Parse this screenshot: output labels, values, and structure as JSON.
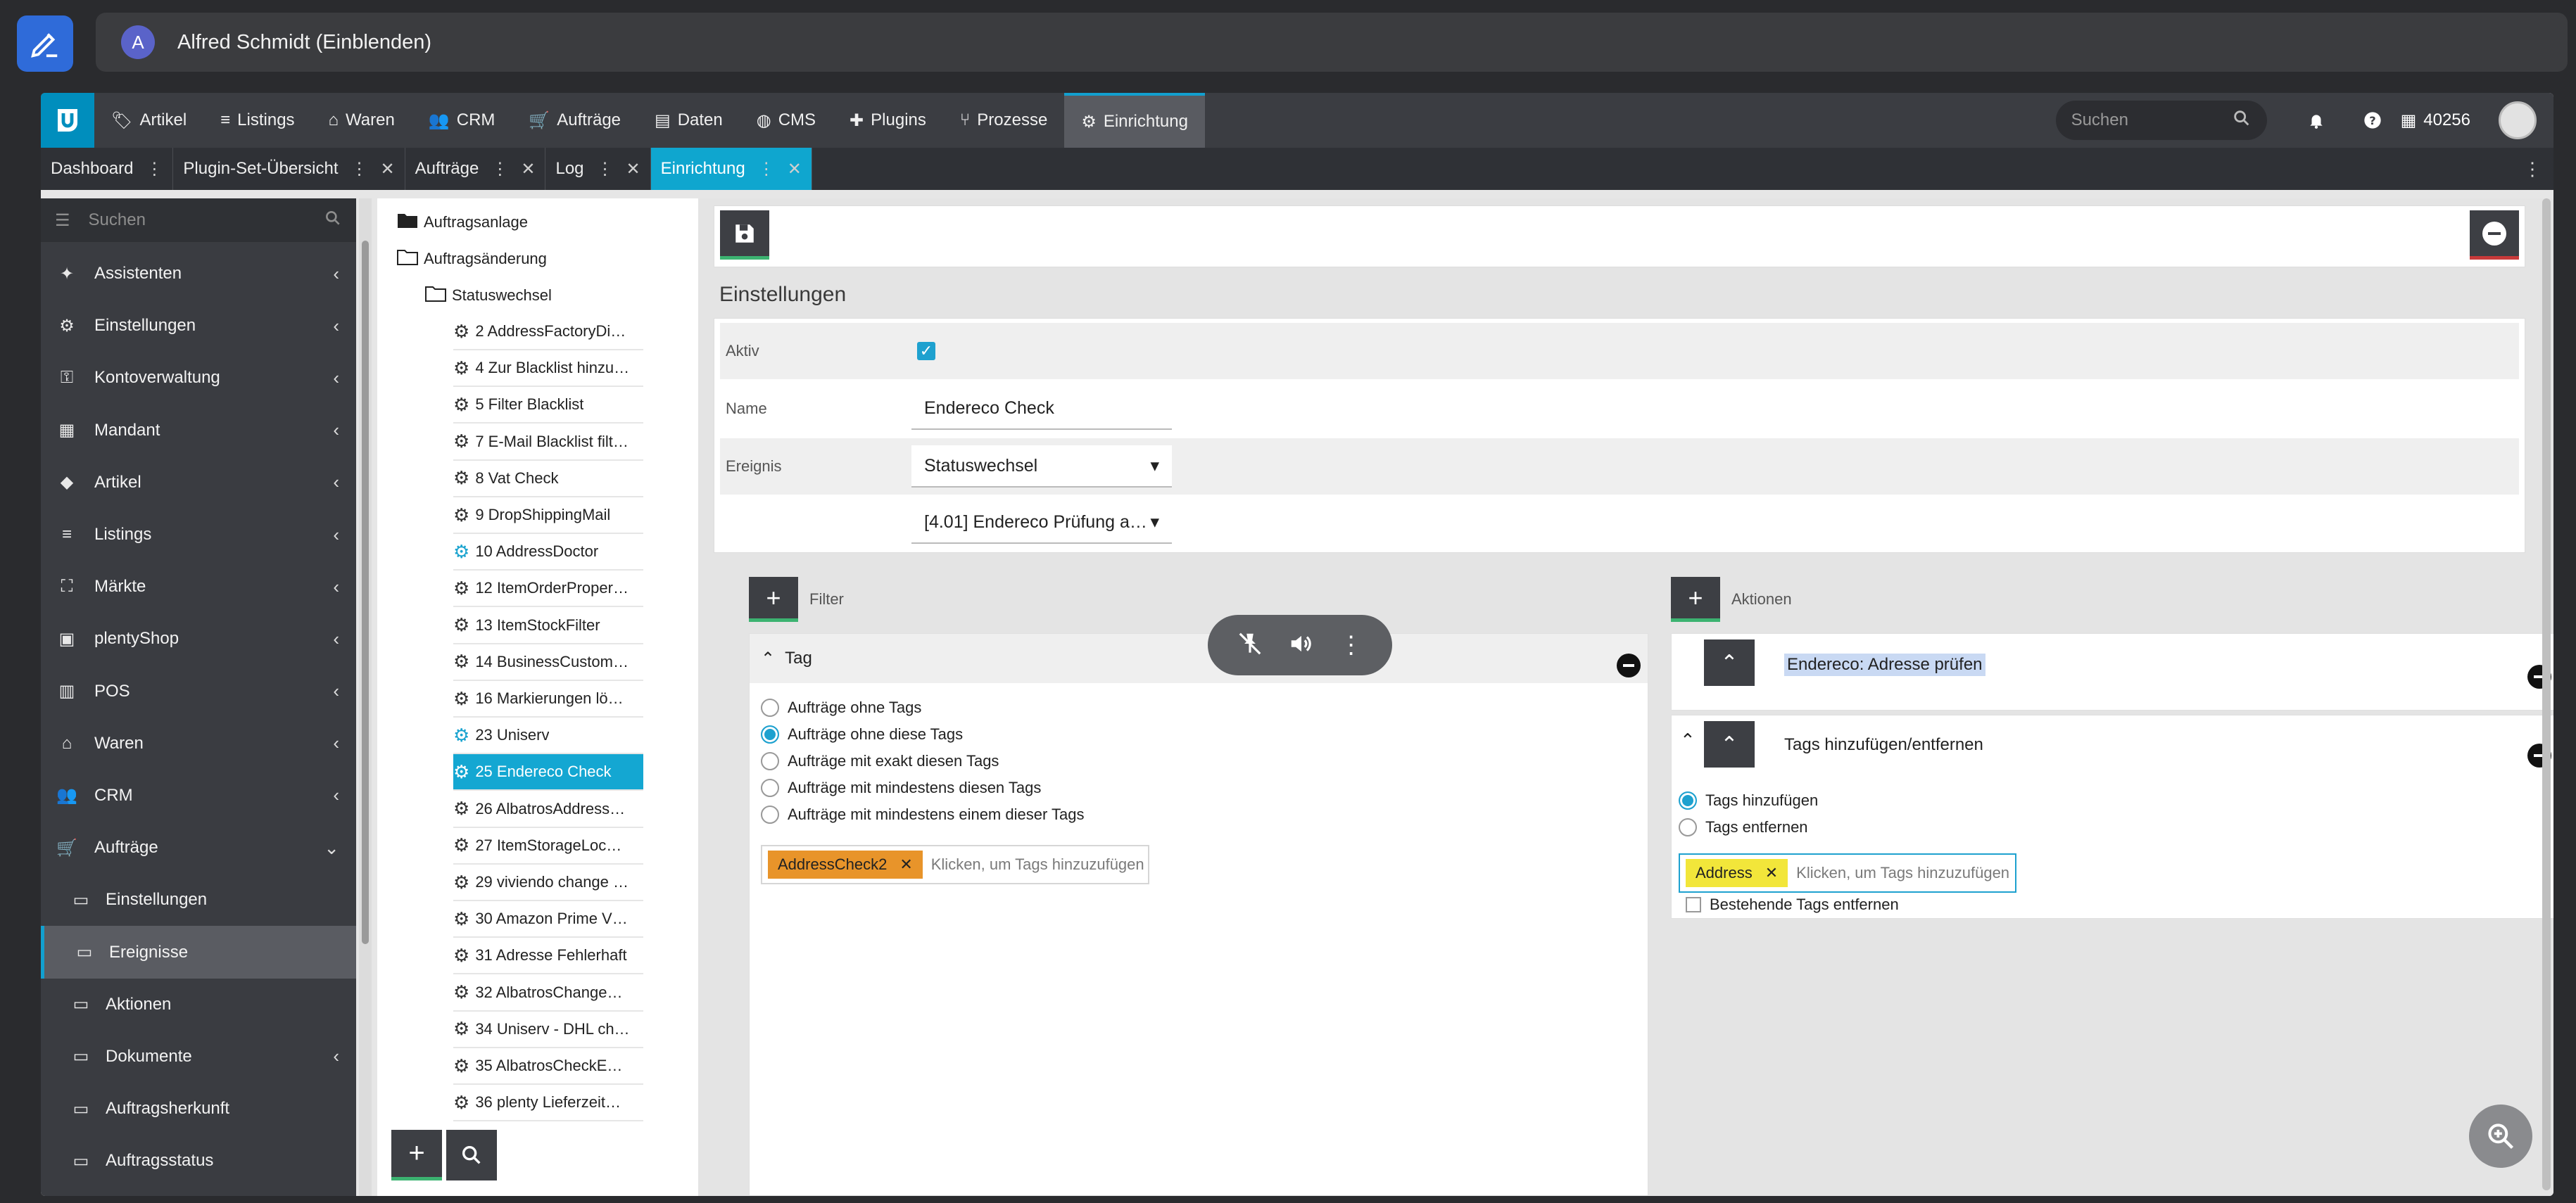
{
  "meeting": {
    "user_initial": "A",
    "user_name": "Alfred Schmidt (Einblenden)"
  },
  "topnav": {
    "items": [
      {
        "label": "Artikel",
        "icon": "tag-icon"
      },
      {
        "label": "Listings",
        "icon": "list-icon"
      },
      {
        "label": "Waren",
        "icon": "warehouse-icon"
      },
      {
        "label": "CRM",
        "icon": "people-icon"
      },
      {
        "label": "Aufträge",
        "icon": "cart-icon"
      },
      {
        "label": "Daten",
        "icon": "database-icon"
      },
      {
        "label": "CMS",
        "icon": "globe-icon"
      },
      {
        "label": "Plugins",
        "icon": "puzzle-icon"
      },
      {
        "label": "Prozesse",
        "icon": "process-icon"
      },
      {
        "label": "Einrichtung",
        "icon": "gear-icon"
      }
    ],
    "active": "Einrichtung",
    "search_placeholder": "Suchen",
    "account_id": "40256"
  },
  "tabs": [
    {
      "label": "Dashboard"
    },
    {
      "label": "Plugin-Set-Übersicht"
    },
    {
      "label": "Aufträge"
    },
    {
      "label": "Log"
    },
    {
      "label": "Einrichtung"
    }
  ],
  "sidebar": {
    "search_placeholder": "Suchen",
    "items": [
      {
        "label": "Assistenten",
        "icon": "wizard-icon",
        "chevron": "‹"
      },
      {
        "label": "Einstellungen",
        "icon": "gear-icon",
        "chevron": "‹"
      },
      {
        "label": "Kontoverwaltung",
        "icon": "key-icon",
        "chevron": "‹"
      },
      {
        "label": "Mandant",
        "icon": "store-icon",
        "chevron": "‹"
      },
      {
        "label": "Artikel",
        "icon": "tag-icon",
        "chevron": "‹"
      },
      {
        "label": "Listings",
        "icon": "list-icon",
        "chevron": "‹"
      },
      {
        "label": "Märkte",
        "icon": "market-icon",
        "chevron": "‹"
      },
      {
        "label": "plentyShop",
        "icon": "shop-icon",
        "chevron": "‹"
      },
      {
        "label": "POS",
        "icon": "pos-icon",
        "chevron": "‹"
      },
      {
        "label": "Waren",
        "icon": "warehouse-icon",
        "chevron": "‹"
      },
      {
        "label": "CRM",
        "icon": "people-icon",
        "chevron": "‹"
      },
      {
        "label": "Aufträge",
        "icon": "cart-icon",
        "chevron": "⌄"
      }
    ],
    "subitems": [
      {
        "label": "Einstellungen"
      },
      {
        "label": "Ereignisse"
      },
      {
        "label": "Aktionen"
      },
      {
        "label": "Dokumente",
        "chevron": "‹"
      },
      {
        "label": "Auftragsherkunft"
      },
      {
        "label": "Auftragsstatus"
      }
    ]
  },
  "tree": {
    "folders": [
      "Auftragsanlage",
      "Auftragsänderung",
      "Statuswechsel"
    ],
    "items": [
      "2 AddressFactoryDi…",
      "4 Zur Blacklist hinzu…",
      "5 Filter Blacklist",
      "7 E-Mail Blacklist filt…",
      "8 Vat Check",
      "9 DropShippingMail",
      "10 AddressDoctor",
      "12 ItemOrderProper…",
      "13 ItemStockFilter",
      "14 BusinessCustom…",
      "16 Markierungen lö…",
      "23 Uniserv",
      "25 Endereco Check",
      "26 AlbatrosAddress…",
      "27 ItemStorageLoc…",
      "29 viviendo change …",
      "30 Amazon Prime V…",
      "31 Adresse Fehlerhaft",
      "32 AlbatrosChange…",
      "34 Uniserv - DHL ch…",
      "35 AlbatrosCheckE…",
      "36 plenty Lieferzeit…"
    ],
    "selected": "25 Endereco Check"
  },
  "main": {
    "title": "Einstellungen",
    "fields": {
      "aktiv_label": "Aktiv",
      "name_label": "Name",
      "name_value": "Endereco Check",
      "ereignis_label": "Ereignis",
      "ereignis_value": "Statuswechsel",
      "status_value": "[4.01] Endereco Prüfung a…"
    },
    "filter": {
      "heading": "Filter",
      "panel_title": "Tag",
      "options": [
        "Aufträge ohne Tags",
        "Aufträge ohne diese Tags",
        "Aufträge mit exakt diesen Tags",
        "Aufträge mit mindestens diesen Tags",
        "Aufträge mit mindestens einem dieser Tags"
      ],
      "selected_index": 1,
      "tag": "AddressCheck2",
      "tag_color": "#e8942a",
      "tag_placeholder": "Klicken, um Tags hinzuzufügen"
    },
    "actions": {
      "heading": "Aktionen",
      "action1_title": "Endereco: Adresse prüfen",
      "action2_title": "Tags hinzufügen/entfernen",
      "options": [
        "Tags hinzufügen",
        "Tags entfernen"
      ],
      "selected_index": 0,
      "tag": "Address",
      "tag_color": "#f2e63a",
      "tag_placeholder": "Klicken, um Tags hinzuzufügen",
      "remove_existing_label": "Bestehende Tags entfernen"
    }
  },
  "colors": {
    "accent": "#12a0cf",
    "nav_bg": "#3b3d42",
    "sidebar_bg": "#3a3c41",
    "save_underline": "#3cb371",
    "danger_underline": "#c83a3a"
  }
}
